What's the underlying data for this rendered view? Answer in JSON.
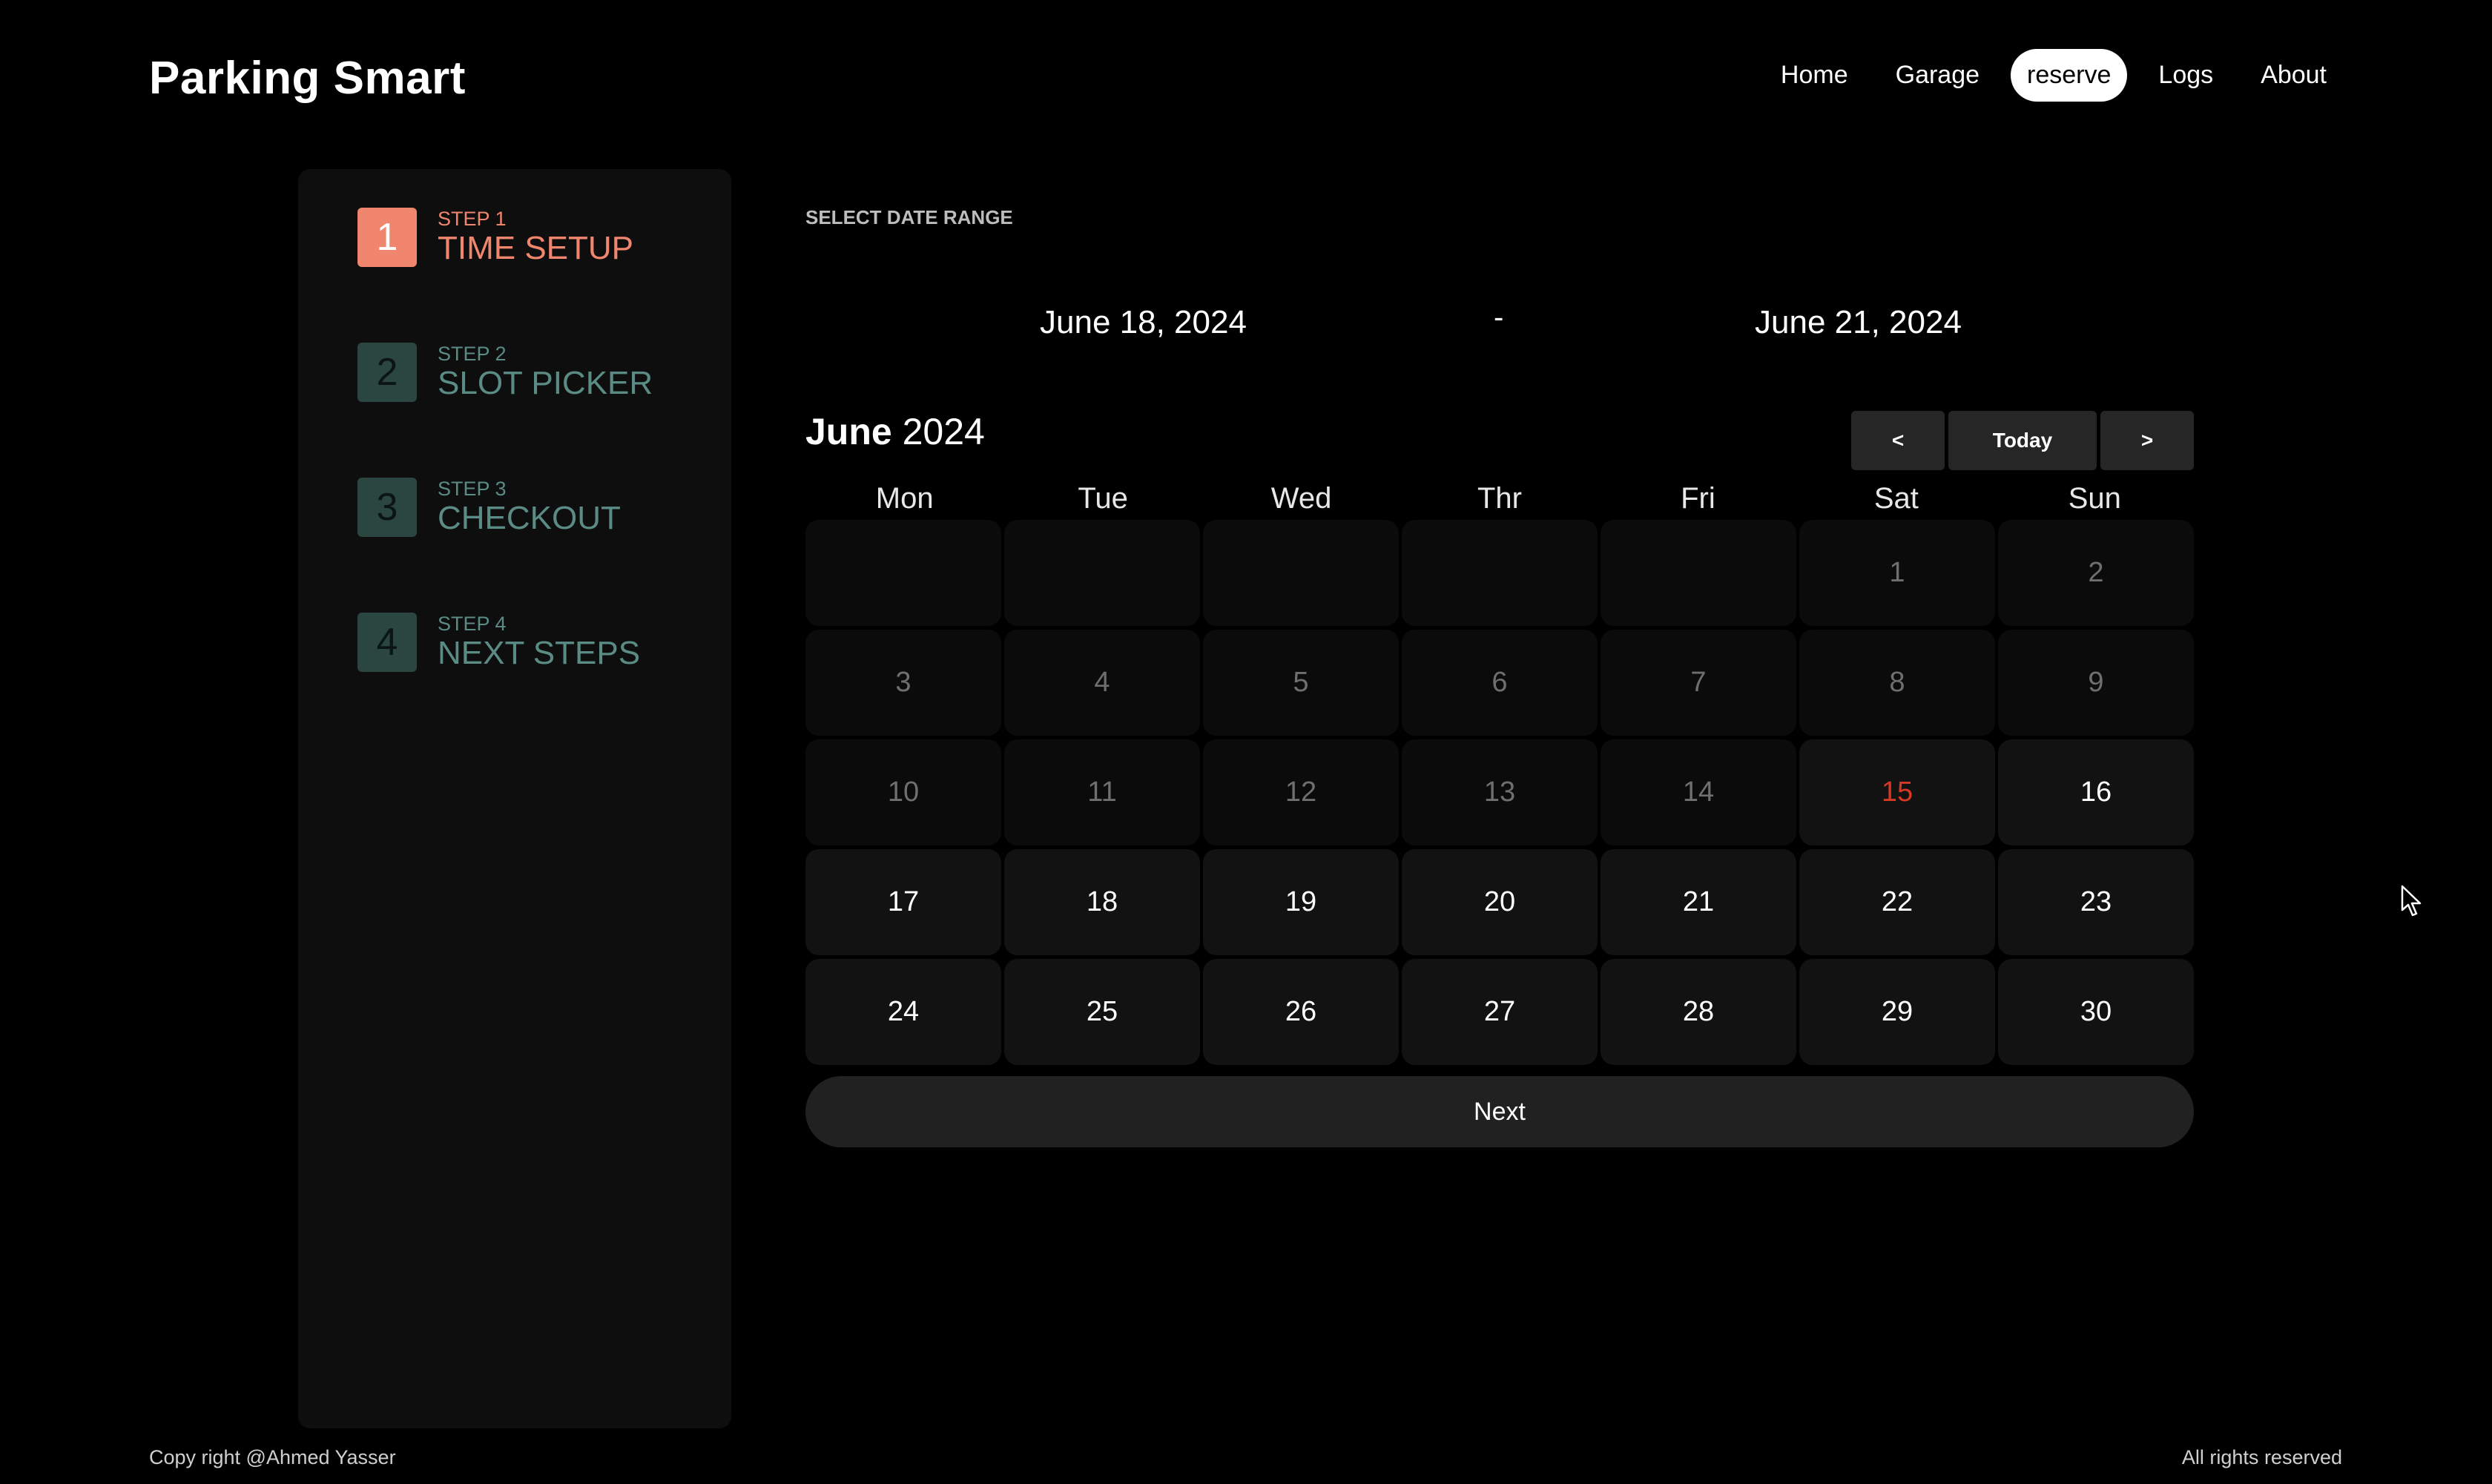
{
  "brand": "Parking Smart",
  "nav": [
    "Home",
    "Garage",
    "reserve",
    "Logs",
    "About"
  ],
  "nav_active": "reserve",
  "steps": [
    {
      "num": "1",
      "label": "STEP 1",
      "title": "TIME SETUP",
      "state": "done"
    },
    {
      "num": "2",
      "label": "STEP 2",
      "title": "SLOT PICKER",
      "state": "pending"
    },
    {
      "num": "3",
      "label": "STEP 3",
      "title": "CHECKOUT",
      "state": "pending"
    },
    {
      "num": "4",
      "label": "STEP 4",
      "title": "NEXT STEPS",
      "state": "pending"
    }
  ],
  "range": {
    "section_label": "SELECT DATE RANGE",
    "start": "June 18, 2024",
    "separator": "-",
    "end": "June 21, 2024"
  },
  "calendar": {
    "month": "June",
    "year": "2024",
    "prev_label": "<",
    "today_label": "Today",
    "next_label": ">",
    "weekdays": [
      "Mon",
      "Tue",
      "Wed",
      "Thr",
      "Fri",
      "Sat",
      "Sun"
    ],
    "leading_blanks": 5,
    "days_in_month": 30,
    "today": 15
  },
  "next_button": "Next",
  "footer": {
    "left": "Copy right @Ahmed Yasser",
    "right": "All rights reserved"
  },
  "colors": {
    "accent": "#f0866e",
    "step_pending_bg": "#2b4540",
    "step_pending_text": "#5b8b85",
    "today": "#d63a24",
    "background": "#000000"
  }
}
